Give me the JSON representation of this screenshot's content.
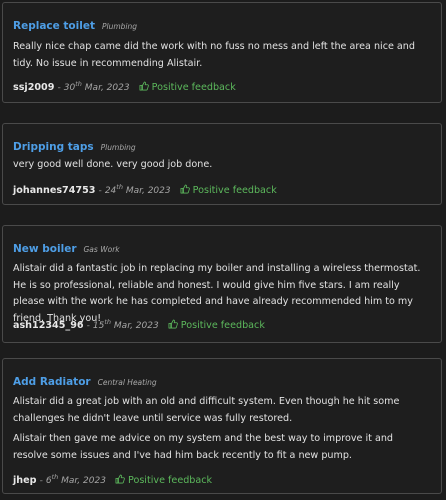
{
  "reviews": [
    {
      "title": "Replace toilet",
      "category": "Plumbing",
      "paragraphs": [
        "Really nice chap came did the work with no fuss no mess and left the area nice and tidy. No issue in recommending Alistair."
      ],
      "user": "ssj2009",
      "date_day": "30",
      "date_suffix": "th",
      "date_rest": "Mar, 2023",
      "feedback": "Positive feedback"
    },
    {
      "title": "Dripping taps",
      "category": "Plumbing",
      "paragraphs": [
        "very good well done. very good job done."
      ],
      "user": "johannes74753",
      "date_day": "24",
      "date_suffix": "th",
      "date_rest": "Mar, 2023",
      "feedback": "Positive feedback"
    },
    {
      "title": "New boiler",
      "category": "Gas Work",
      "paragraphs": [
        "Alistair did a fantastic job in replacing my boiler and installing a wireless thermostat. He is so professional, reliable and honest. I would give him five stars. I am really please with the work he has completed and have already recommended him to my friend. Thank you!"
      ],
      "user": "ash12345_96",
      "date_day": "15",
      "date_suffix": "th",
      "date_rest": "Mar, 2023",
      "feedback": "Positive feedback"
    },
    {
      "title": "Add Radiator",
      "category": "Central Heating",
      "paragraphs": [
        "Alistair did a great job with an old and difficult system. Even though he hit some challenges he didn't leave until service was fully restored.",
        "Alistair then gave me advice on my system and the best way to improve it and resolve some issues and I've had him back recently to fit a new pump."
      ],
      "user": "jhep",
      "date_day": "6",
      "date_suffix": "th",
      "date_rest": "Mar, 2023",
      "feedback": "Positive feedback"
    }
  ],
  "colors": {
    "title": "#4e9ee6",
    "positive": "#5cb85c",
    "border": "#4a4a4a"
  },
  "icons": {
    "feedback": "thumbs-up-icon"
  }
}
